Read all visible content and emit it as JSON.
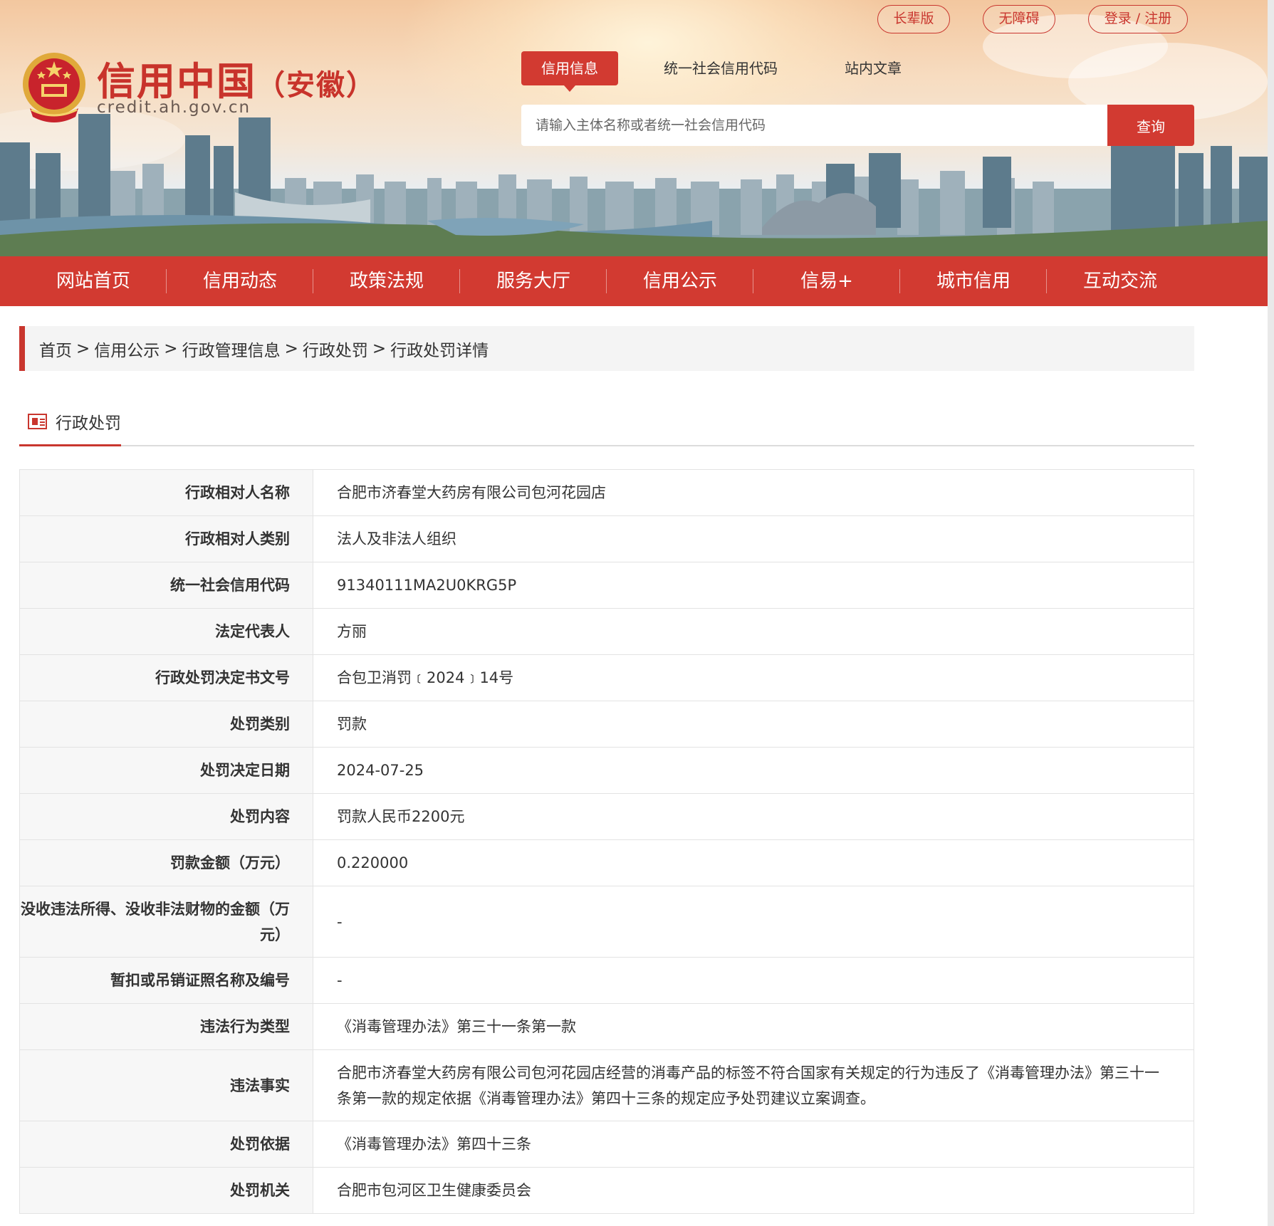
{
  "header": {
    "top_links": [
      "长辈版",
      "无障碍",
      "登录 / 注册"
    ],
    "logo": {
      "title": "信用中国",
      "region": "（安徽）",
      "url": "credit.ah.gov.cn"
    },
    "search_tabs": [
      "信用信息",
      "统一社会信用代码",
      "站内文章"
    ],
    "active_search_tab": "信用信息",
    "search_placeholder": "请输入主体名称或者统一社会信用代码",
    "search_button": "查询"
  },
  "nav": {
    "items": [
      "网站首页",
      "信用动态",
      "政策法规",
      "服务大厅",
      "信用公示",
      "信易+",
      "城市信用",
      "互动交流"
    ]
  },
  "breadcrumb": {
    "items": [
      "首页",
      "信用公示",
      "行政管理信息",
      "行政处罚",
      "行政处罚详情"
    ],
    "separator": ">"
  },
  "section": {
    "title": "行政处罚"
  },
  "details": [
    {
      "label": "行政相对人名称",
      "value": "合肥市济春堂大药房有限公司包河花园店"
    },
    {
      "label": "行政相对人类别",
      "value": "法人及非法人组织"
    },
    {
      "label": "统一社会信用代码",
      "value": "91340111MA2U0KRG5P"
    },
    {
      "label": "法定代表人",
      "value": "方丽"
    },
    {
      "label": "行政处罚决定书文号",
      "value": "合包卫消罚﹝2024﹞14号"
    },
    {
      "label": "处罚类别",
      "value": "罚款"
    },
    {
      "label": "处罚决定日期",
      "value": "2024-07-25"
    },
    {
      "label": "处罚内容",
      "value": "罚款人民币2200元"
    },
    {
      "label": "罚款金额（万元）",
      "value": "0.220000"
    },
    {
      "label": "没收违法所得、没收非法财物的金额（万元）",
      "value": "-"
    },
    {
      "label": "暂扣或吊销证照名称及编号",
      "value": "-"
    },
    {
      "label": "违法行为类型",
      "value": "《消毒管理办法》第三十一条第一款"
    },
    {
      "label": "违法事实",
      "value": "合肥市济春堂大药房有限公司包河花园店经营的消毒产品的标签不符合国家有关规定的行为违反了《消毒管理办法》第三十一条第一款的规定依据《消毒管理办法》第四十三条的规定应予处罚建议立案调查。"
    },
    {
      "label": "处罚依据",
      "value": "《消毒管理办法》第四十三条"
    },
    {
      "label": "处罚机关",
      "value": "合肥市包河区卫生健康委员会"
    }
  ],
  "colors": {
    "brand_red": "#d23a31",
    "label_bg": "#f7f7f7",
    "border": "#e3e3e3"
  }
}
